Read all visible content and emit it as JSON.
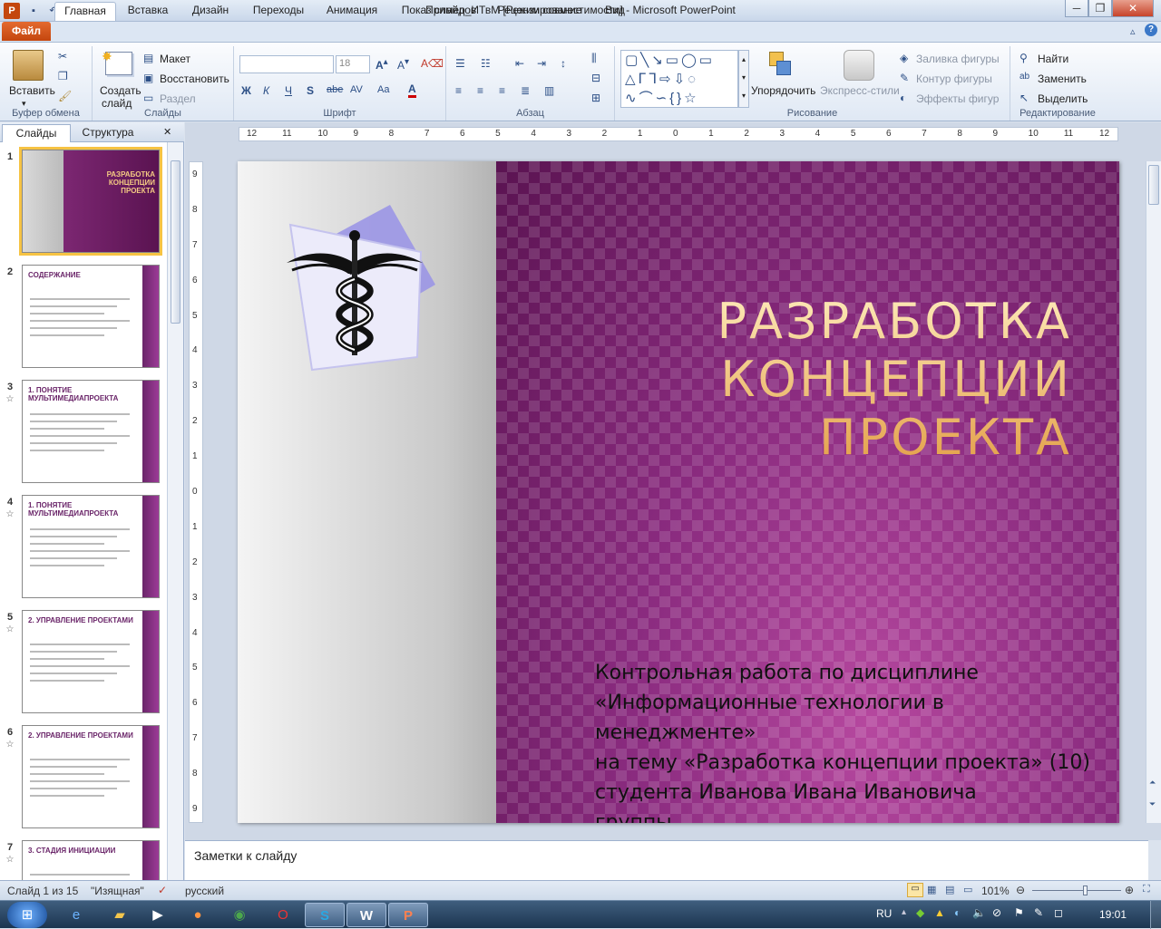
{
  "window": {
    "title": "Пример_ИТвМ [Режим совместимости] - Microsoft PowerPoint",
    "app_icon": "powerpoint-icon"
  },
  "tabs": {
    "file": "Файл",
    "items": [
      "Главная",
      "Вставка",
      "Дизайн",
      "Переходы",
      "Анимация",
      "Показ слайдов",
      "Рецензирование",
      "Вид"
    ],
    "active": "Главная"
  },
  "ribbon": {
    "clipboard": {
      "paste": "Вставить",
      "label": "Буфер обмена"
    },
    "slides": {
      "new_slide_1": "Создать",
      "new_slide_2": "слайд",
      "layout": "Макет",
      "reset": "Восстановить",
      "section": "Раздел",
      "label": "Слайды"
    },
    "font": {
      "size": "18",
      "label": "Шрифт",
      "bold": "Ж",
      "italic": "К",
      "underline": "Ч",
      "shadow": "S",
      "strike": "abe",
      "spacing": "AV",
      "case": "Aa"
    },
    "paragraph": {
      "label": "Абзац"
    },
    "drawing": {
      "arrange": "Упорядочить",
      "quick_styles": "Экспресс-стили",
      "fill": "Заливка фигуры",
      "outline": "Контур фигуры",
      "effects": "Эффекты фигур",
      "label": "Рисование"
    },
    "editing": {
      "find": "Найти",
      "replace": "Заменить",
      "select": "Выделить",
      "label": "Редактирование"
    }
  },
  "panel": {
    "tabs": [
      "Слайды",
      "Структура"
    ],
    "thumbs": [
      {
        "num": "1",
        "title": "РАЗРАБОТКА КОНЦЕПЦИИ ПРОЕКТА",
        "star": ""
      },
      {
        "num": "2",
        "title": "СОДЕРЖАНИЕ",
        "star": ""
      },
      {
        "num": "3",
        "title": "1. ПОНЯТИЕ МУЛЬТИМЕДИАПРОЕКТА",
        "star": "☆"
      },
      {
        "num": "4",
        "title": "1. ПОНЯТИЕ МУЛЬТИМЕДИАПРОЕКТА",
        "star": "☆"
      },
      {
        "num": "5",
        "title": "2. УПРАВЛЕНИЕ ПРОЕКТАМИ",
        "star": "☆"
      },
      {
        "num": "6",
        "title": "2. УПРАВЛЕНИЕ ПРОЕКТАМИ",
        "star": "☆"
      },
      {
        "num": "7",
        "title": "3. СТАДИЯ ИНИЦИАЦИИ",
        "star": "☆"
      }
    ]
  },
  "ruler": {
    "h": [
      "12",
      "11",
      "10",
      "9",
      "8",
      "7",
      "6",
      "5",
      "4",
      "3",
      "2",
      "1",
      "0",
      "1",
      "2",
      "3",
      "4",
      "5",
      "6",
      "7",
      "8",
      "9",
      "10",
      "11",
      "12"
    ],
    "v": [
      "9",
      "8",
      "7",
      "6",
      "5",
      "4",
      "3",
      "2",
      "1",
      "0",
      "1",
      "2",
      "3",
      "4",
      "5",
      "6",
      "7",
      "8",
      "9"
    ]
  },
  "slide": {
    "title_1": "РАЗРАБОТКА",
    "title_2": "КОНЦЕПЦИИ ПРОЕКТА",
    "sub_1": "Контрольная работа по дисциплине",
    "sub_2": "«Информационные  технологии в менеджменте»",
    "sub_3": "на тему «Разработка  концепции  проекта»  (10)",
    "sub_4": "студента  Иванова  Ивана  Ивановича",
    "sub_5": "группы  …",
    "image": "caduceus-clipart"
  },
  "notes": {
    "placeholder": "Заметки к слайду"
  },
  "status": {
    "slide": "Слайд 1 из 15",
    "theme": "\"Изящная\"",
    "lang": "русский",
    "zoom": "101%",
    "zoom_level": 0.6
  },
  "taskbar": {
    "lang": "RU",
    "time": "19:01"
  },
  "colors": {
    "file_tab": "#d2531a",
    "slide_purple": "#8a2b7f",
    "title_gold": "#f3c983"
  }
}
